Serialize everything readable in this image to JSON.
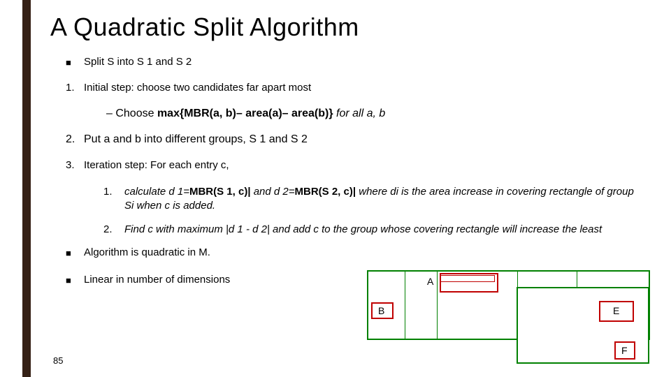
{
  "title": "A Quadratic Split Algorithm",
  "bullets": {
    "intro_marker": "■",
    "intro": "Split S into S 1 and S 2",
    "step1_marker": "1.",
    "step1": "Initial step: choose two candidates far apart most",
    "step1_sub_prefix": "–   Choose ",
    "step1_sub_bold": "max{MBR(a, b)– area(a)– area(b)}",
    "step1_sub_suffix_ital": " for all a, b",
    "step2_marker": "2.",
    "step2": "Put a and b into different groups, S 1 and S 2",
    "step3_marker": "3.",
    "step3": "Iteration step: For each entry c,",
    "step3_1_marker": "1.",
    "step3_1_a": "calculate d 1=",
    "step3_1_b": "MBR(S 1, c)|",
    "step3_1_c": " and d 2=",
    "step3_1_d": "MBR(S 2, c)|",
    "step3_1_e": " where di is the area increase in covering rectangle of group Si when c is added.",
    "step3_2_marker": "2.",
    "step3_2": "Find c with maximum |d 1 - d 2| and add c to the group whose covering rectangle will increase the least",
    "tail1_marker": "■",
    "tail1": "Algorithm is quadratic in M.",
    "tail2_marker": "■",
    "tail2": "Linear in number of dimensions"
  },
  "diagram": {
    "A": "A",
    "B": "B",
    "E": "E",
    "F": "F"
  },
  "page": "85"
}
